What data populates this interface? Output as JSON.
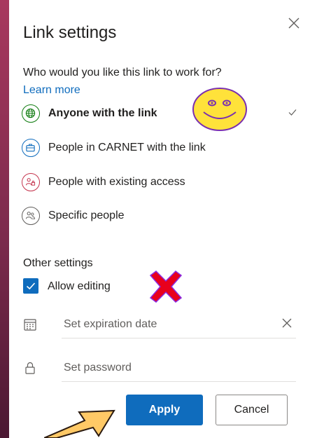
{
  "dialog": {
    "title": "Link settings",
    "close_icon": "close-icon"
  },
  "audience": {
    "question": "Who would you like this link to work for?",
    "learn_more": "Learn more",
    "options": [
      {
        "label": "Anyone with the link",
        "icon": "globe-icon",
        "color": "#107c10",
        "selected": true
      },
      {
        "label": "People in CARNET with the link",
        "icon": "briefcase-icon",
        "color": "#0f6cbd",
        "selected": false
      },
      {
        "label": "People with existing access",
        "icon": "people-lock-icon",
        "color": "#c4314b",
        "selected": false
      },
      {
        "label": "Specific people",
        "icon": "people-icon",
        "color": "#605e5c",
        "selected": false
      }
    ]
  },
  "other_settings": {
    "heading": "Other settings",
    "allow_editing": {
      "label": "Allow editing",
      "checked": true
    },
    "expiration_placeholder": "Set expiration date",
    "password_placeholder": "Set password"
  },
  "buttons": {
    "apply": "Apply",
    "cancel": "Cancel"
  },
  "colors": {
    "accent": "#0f6cbd",
    "annotation_yellow": "#ffe23a",
    "annotation_red": "#e8001c",
    "annotation_arrow": "#ffc966"
  }
}
